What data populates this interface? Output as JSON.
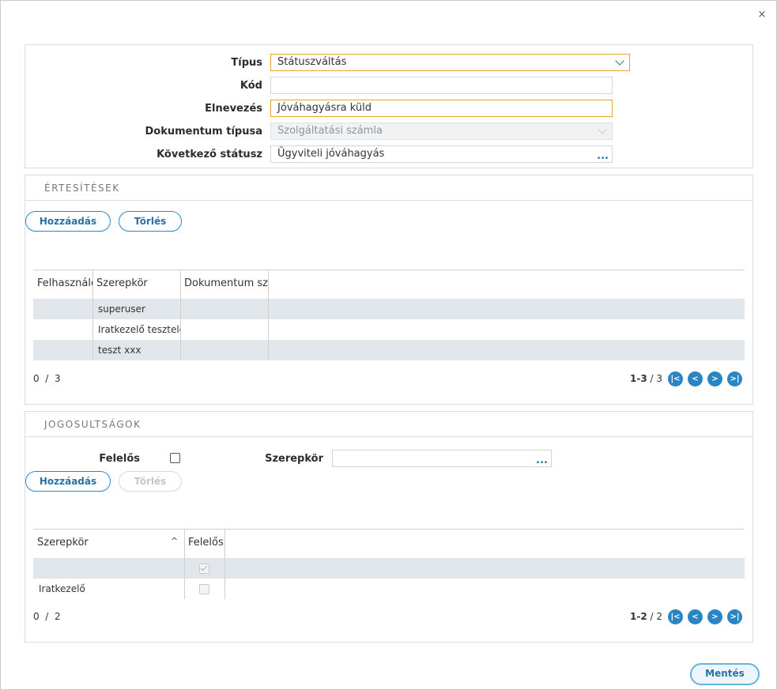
{
  "dialog": {
    "close_icon": "close-icon ×",
    "close_glyph": "×"
  },
  "form": {
    "tipus_label": "Típus",
    "tipus_value": "Státuszváltás",
    "kod_label": "Kód",
    "kod_value": "",
    "elnevezes_label": "Elnevezés",
    "elnevezes_value": "Jóváhagyásra küld",
    "dokumentum_tipusa_label": "Dokumentum típusa",
    "dokumentum_tipusa_value": "Szolgáltatási számla",
    "kovetkezo_statusz_label": "Következő státusz",
    "kovetkezo_statusz_value": "Ügyviteli jóváhagyás",
    "ellipsis": "..."
  },
  "notifications": {
    "title": "ÉRTESÍTÉSEK",
    "add_label": "Hozzáadás",
    "delete_label": "Törlés",
    "columns": [
      "Felhasználó",
      "Szerepkör",
      "Dokumentum szerepkör"
    ],
    "rows": [
      [
        "",
        "superuser",
        ""
      ],
      [
        "",
        "Iratkezelő tesztelés",
        ""
      ],
      [
        "",
        "teszt xxx",
        ""
      ]
    ],
    "selected_count": "0",
    "total_count": "3",
    "count_separator": "/",
    "range": "1-3",
    "range_total": "3"
  },
  "permissions": {
    "title": "JOGOSULTSÁGOK",
    "felelos_label": "Felelős",
    "felelos_checked": false,
    "szerepkor_label": "Szerepkör",
    "szerepkor_value": "",
    "add_label": "Hozzáadás",
    "delete_label": "Törlés",
    "columns": [
      "Szerepkör",
      "Felelős"
    ],
    "sort_indicator": "^",
    "rows": [
      {
        "szerepkor": "",
        "felelos": true
      },
      {
        "szerepkor": "Iratkezelő",
        "felelos": false
      }
    ],
    "selected_count": "0",
    "total_count": "2",
    "count_separator": "/",
    "range": "1-2",
    "range_total": "2"
  },
  "pager_icons": {
    "first": "first-page-icon",
    "prev": "prev-page-icon",
    "next": "next-page-icon",
    "last": "last-page-icon"
  },
  "footer": {
    "save_label": "Mentés"
  },
  "colors": {
    "accent": "#2a86c3",
    "focus_border": "#e5a62c",
    "row_alt": "#e1e6ea"
  }
}
